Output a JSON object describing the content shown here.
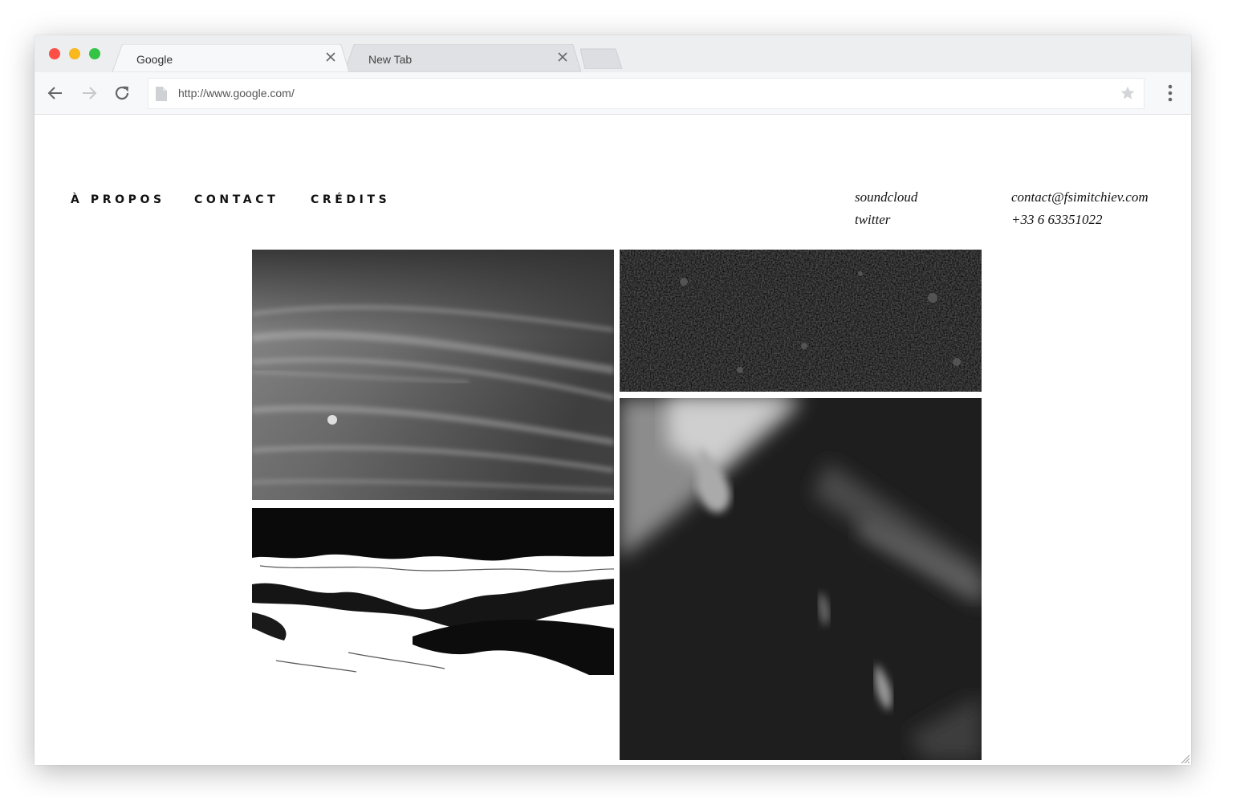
{
  "browser": {
    "tabs": [
      {
        "label": "Google",
        "active": true
      },
      {
        "label": "New Tab",
        "active": false
      }
    ],
    "url": "http://www.google.com/",
    "icons": [
      "back-arrow-icon",
      "forward-arrow-icon",
      "reload-icon",
      "page-icon",
      "star-icon",
      "menu-icon",
      "close-icon"
    ]
  },
  "site": {
    "nav": {
      "about": "À PROPOS",
      "contact": "CONTACT",
      "credits": "CRÉDITS"
    },
    "social": {
      "soundcloud": "soundcloud",
      "twitter": "twitter"
    },
    "contact_info": {
      "email": "contact@fsimitchiev.com",
      "phone": "+33 6 63351022"
    },
    "gallery": [
      {
        "name": "sky-photo",
        "tone": "grayscale"
      },
      {
        "name": "gravel-photo",
        "tone": "grayscale"
      },
      {
        "name": "shore-photo",
        "tone": "high-contrast"
      },
      {
        "name": "blur-photo",
        "tone": "grayscale"
      }
    ]
  }
}
